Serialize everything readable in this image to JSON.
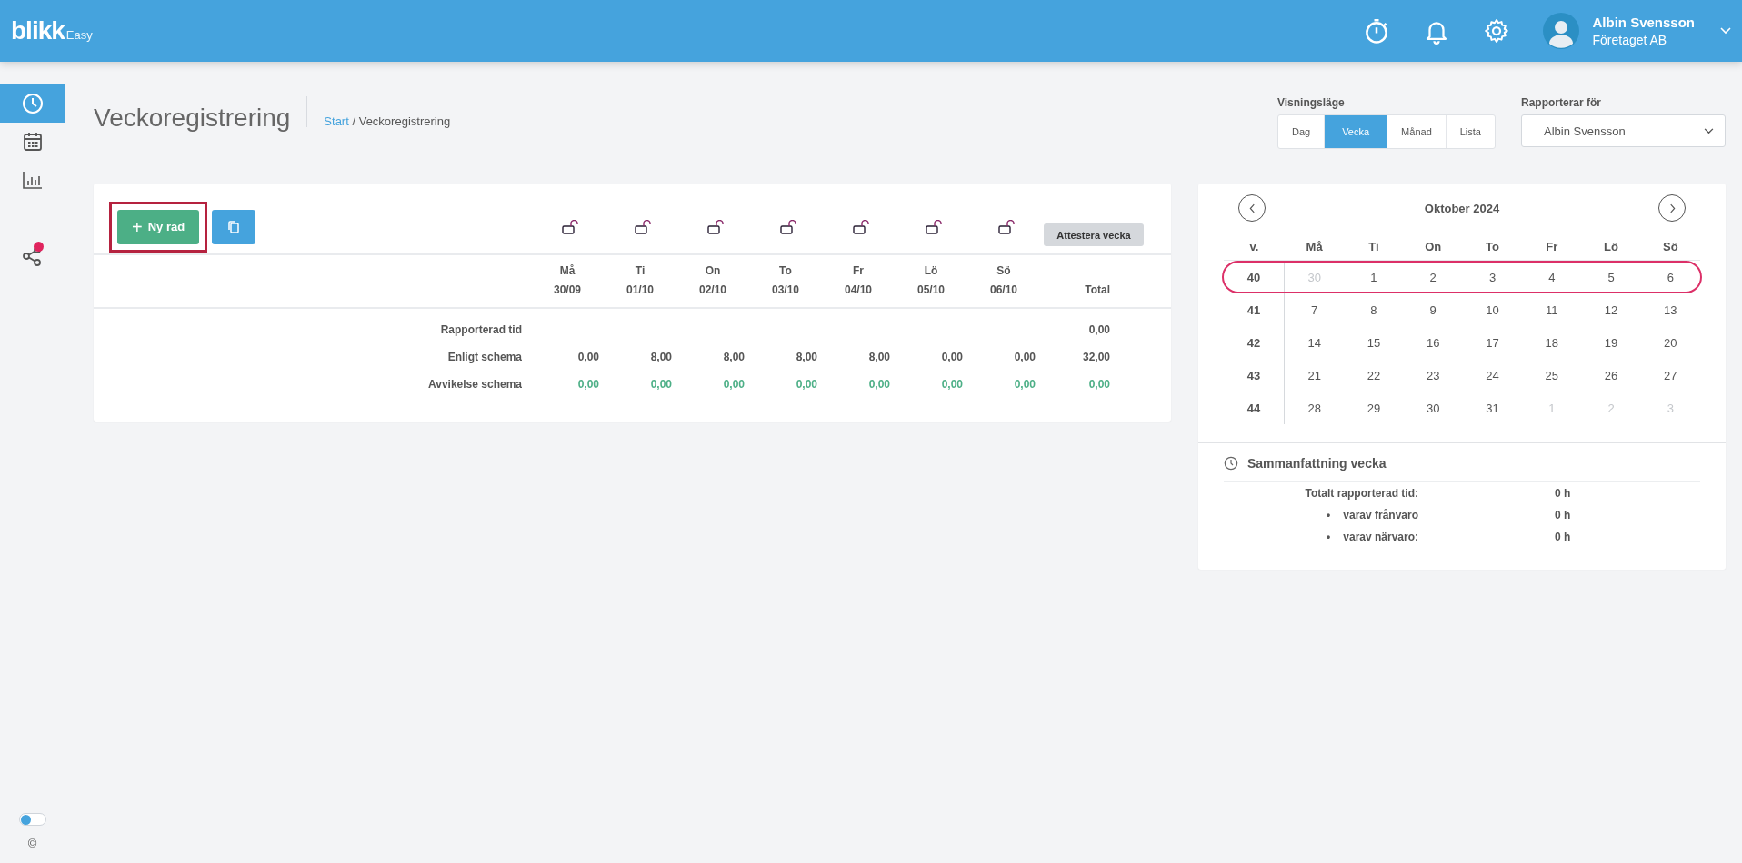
{
  "header": {
    "logo": "blikk",
    "logo_suffix": "Easy",
    "user_name": "Albin Svensson",
    "company": "Företaget AB"
  },
  "sidebar": {
    "items": [
      {
        "kind": "clock",
        "selected": true
      },
      {
        "kind": "calendar",
        "selected": false
      },
      {
        "kind": "chart",
        "selected": false
      },
      {
        "kind": "share",
        "selected": false,
        "notification": true
      }
    ],
    "toggle": {
      "on": false
    },
    "copyright": "©"
  },
  "page": {
    "title": "Veckoregistrering",
    "breadcrumb": [
      {
        "label": "Start",
        "link": true
      },
      {
        "label": "Veckoregistrering",
        "link": false
      }
    ],
    "separator": "/"
  },
  "view_mode": {
    "label": "Visningsläge",
    "tabs": [
      {
        "label": "Dag",
        "selected": false
      },
      {
        "label": "Vecka",
        "selected": true
      },
      {
        "label": "Månad",
        "selected": false
      },
      {
        "label": "Lista",
        "selected": false
      }
    ]
  },
  "reporting_for": {
    "label": "Rapporterar för",
    "value": "Albin Svensson"
  },
  "week": {
    "new_row_button": {
      "label": "Ny rad",
      "icon": "+",
      "highlighted": true
    },
    "approve_button": "Attestera vecka",
    "days": [
      {
        "name": "Må",
        "date": "30/09"
      },
      {
        "name": "Ti",
        "date": "01/10"
      },
      {
        "name": "On",
        "date": "02/10"
      },
      {
        "name": "To",
        "date": "03/10"
      },
      {
        "name": "Fr",
        "date": "04/10"
      },
      {
        "name": "Lö",
        "date": "05/10"
      },
      {
        "name": "Sö",
        "date": "06/10"
      }
    ],
    "total_label": "Total",
    "rows": [
      {
        "label": "Rapporterad tid",
        "kind": "plain",
        "total": "0,00"
      },
      {
        "label": "Enligt schema",
        "kind": "plain",
        "values": [
          "0,00",
          "8,00",
          "8,00",
          "8,00",
          "8,00",
          "0,00",
          "0,00"
        ],
        "total": "32,00"
      },
      {
        "label": "Avvikelse schema",
        "kind": "deviation",
        "values": [
          "0,00",
          "0,00",
          "0,00",
          "0,00",
          "0,00",
          "0,00",
          "0,00"
        ],
        "total": "0,00"
      }
    ]
  },
  "calendar": {
    "title": "Oktober 2024",
    "week_label": "v.",
    "weekdays": [
      "Må",
      "Ti",
      "On",
      "To",
      "Fr",
      "Lö",
      "Sö"
    ],
    "weeks": [
      {
        "number": "40",
        "selected": true,
        "days": [
          {
            "d": "30",
            "muted": true
          },
          {
            "d": "1",
            "muted": false
          },
          {
            "d": "2",
            "muted": false
          },
          {
            "d": "3",
            "muted": false
          },
          {
            "d": "4",
            "muted": false
          },
          {
            "d": "5",
            "muted": false
          },
          {
            "d": "6",
            "muted": false
          }
        ]
      },
      {
        "number": "41",
        "selected": false,
        "days": [
          {
            "d": "7",
            "muted": false
          },
          {
            "d": "8",
            "muted": false
          },
          {
            "d": "9",
            "muted": false
          },
          {
            "d": "10",
            "muted": false
          },
          {
            "d": "11",
            "muted": false
          },
          {
            "d": "12",
            "muted": false
          },
          {
            "d": "13",
            "muted": false
          }
        ]
      },
      {
        "number": "42",
        "selected": false,
        "days": [
          {
            "d": "14",
            "muted": false
          },
          {
            "d": "15",
            "muted": false
          },
          {
            "d": "16",
            "muted": false
          },
          {
            "d": "17",
            "muted": false
          },
          {
            "d": "18",
            "muted": false
          },
          {
            "d": "19",
            "muted": false
          },
          {
            "d": "20",
            "muted": false
          }
        ]
      },
      {
        "number": "43",
        "selected": false,
        "days": [
          {
            "d": "21",
            "muted": false
          },
          {
            "d": "22",
            "muted": false
          },
          {
            "d": "23",
            "muted": false
          },
          {
            "d": "24",
            "muted": false
          },
          {
            "d": "25",
            "muted": false
          },
          {
            "d": "26",
            "muted": false
          },
          {
            "d": "27",
            "muted": false
          }
        ]
      },
      {
        "number": "44",
        "selected": false,
        "days": [
          {
            "d": "28",
            "muted": false
          },
          {
            "d": "29",
            "muted": false
          },
          {
            "d": "30",
            "muted": false
          },
          {
            "d": "31",
            "muted": false
          },
          {
            "d": "1",
            "muted": true
          },
          {
            "d": "2",
            "muted": true
          },
          {
            "d": "3",
            "muted": true
          }
        ]
      }
    ]
  },
  "summary": {
    "title": "Sammanfattning vecka",
    "rows": [
      {
        "label": "Totalt rapporterad tid:",
        "value": "0 h"
      },
      {
        "marker": "•",
        "label": "varav frånvaro",
        "value": "0 h"
      },
      {
        "marker": "•",
        "label": "varav närvaro:",
        "value": "0 h"
      }
    ]
  }
}
